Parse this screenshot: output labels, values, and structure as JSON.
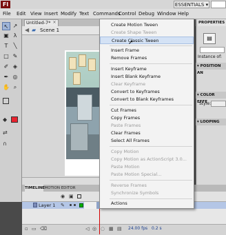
{
  "app": {
    "logo_text": "Fl",
    "workspace_label": "ESSENTIALS ▾"
  },
  "menu_bar": [
    "File",
    "Edit",
    "View",
    "Insert",
    "Modify",
    "Text",
    "Commands",
    "Control",
    "Debug",
    "Window",
    "Help"
  ],
  "document": {
    "tab_title": "Untitled-7*",
    "close_glyph": "×",
    "scene_label": "Scene 1"
  },
  "tools": [
    "↖",
    "↗",
    "▣",
    "λ",
    "T",
    "╲",
    "□",
    "✎",
    "✐",
    "◈",
    "✒",
    "◎",
    "✋",
    "⌕"
  ],
  "context_menu": {
    "items": [
      {
        "label": "Create Motion Tween",
        "disabled": false
      },
      {
        "label": "Create Shape Tween",
        "disabled": true
      },
      {
        "label": "Create Classic Tween",
        "disabled": false,
        "hover": true
      },
      {
        "label": "Insert Frame",
        "disabled": false
      },
      {
        "label": "Remove Frames",
        "disabled": false
      },
      {
        "label": "Insert Keyframe",
        "disabled": false
      },
      {
        "label": "Insert Blank Keyframe",
        "disabled": false
      },
      {
        "label": "Clear Keyframe",
        "disabled": true
      },
      {
        "label": "Convert to Keyframes",
        "disabled": false
      },
      {
        "label": "Convert to Blank Keyframes",
        "disabled": false
      },
      {
        "label": "Cut Frames",
        "disabled": false
      },
      {
        "label": "Copy Frames",
        "disabled": false
      },
      {
        "label": "Paste Frames",
        "disabled": true
      },
      {
        "label": "Clear Frames",
        "disabled": false
      },
      {
        "label": "Select All Frames",
        "disabled": false
      },
      {
        "label": "Copy Motion",
        "disabled": true
      },
      {
        "label": "Copy Motion as ActionScript 3.0...",
        "disabled": true
      },
      {
        "label": "Paste Motion",
        "disabled": true
      },
      {
        "label": "Paste Motion Special...",
        "disabled": true
      },
      {
        "label": "Reverse Frames",
        "disabled": true
      },
      {
        "label": "Synchronize Symbols",
        "disabled": true
      },
      {
        "label": "Actions",
        "disabled": false
      }
    ]
  },
  "properties_panel": {
    "tab_label": "PROPERTIES",
    "instance_label": "Instance of:",
    "position_header": "▾ POSITION AN",
    "color_header": "▾ COLOR EFFE",
    "style_label": "Style:",
    "looping_header": "▾ LOOPING"
  },
  "timeline": {
    "tab_timeline": "TIMELINE",
    "tab_motion_editor": "MOTION EDITOR",
    "layer_name": "Layer 1",
    "fps": "24.00 fps",
    "time": "0.2 s"
  },
  "colors": {
    "stroke_swatch": "#000000",
    "fill_swatch": "#e8232f",
    "menu_hover": "#d4e2f5",
    "layer_selected": "#b4c6e6",
    "playhead": "#d40000"
  }
}
